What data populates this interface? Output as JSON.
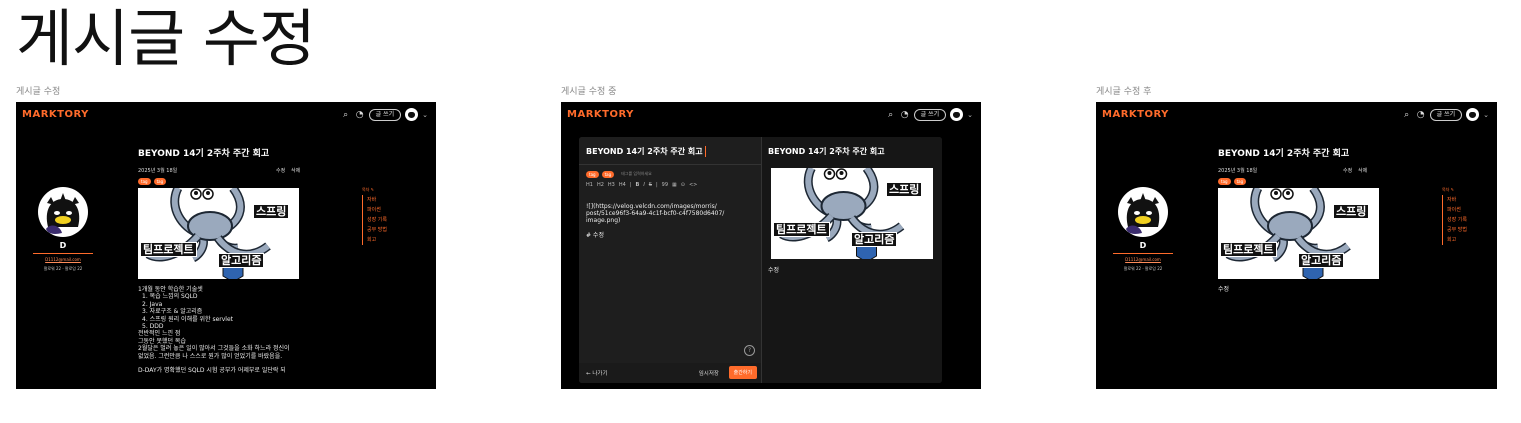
{
  "page_title": "게시글 수정",
  "captions": [
    "게시글 수정",
    "게시글 수정 중",
    "게시글 수정 후"
  ],
  "header": {
    "logo": "MARKTORY",
    "write_button": "글 쓰기",
    "icons": [
      "search-icon",
      "bell-icon",
      "avatar",
      "chevron-down-icon"
    ]
  },
  "post": {
    "title": "BEYOND 14기 2주차 주간 회고",
    "date": "2025년 3월 18일",
    "edit": "수정",
    "delete": "삭제",
    "tags": [
      "tag",
      "tag"
    ],
    "figure_labels": {
      "spring": "스프링",
      "team": "팀프로젝트",
      "algo": "알고리즘"
    },
    "body": [
      "1개월 동안 학습한 기술셋",
      "1. 복습 느낌의 SQLD",
      "2. Java",
      "3. 자료구조 & 알고리즘",
      "4. 스프링 원리 이해를 위한 servlet",
      "5. DDD",
      "전반적인 느낀 점",
      "그동안 못했던 복습",
      "2월달은 벌려 놓은 일이 많아서 그것들을 소화 하느라 정신이",
      "없었음. 그런만큼 나 스스로 뭔가 많이 얻었기를 바랐음을.",
      "",
      "D-DAY가 명확했던 SQLD 시험 공부가 어제부로 일단락 되"
    ],
    "edited_body": "수정"
  },
  "profile": {
    "name": "D",
    "email": "D1112@mail.com",
    "follow": "팔로워 22 · 팔로잉 22"
  },
  "toc": {
    "head": "목차 ✎",
    "items": [
      "자바",
      "파이썬",
      "성장 기록",
      "공부 방법",
      "회고"
    ]
  },
  "editor": {
    "title": "BEYOND 14기 2주차 주간 회고",
    "tag_placeholder": "태그를 입력하세요",
    "toolbar": [
      "H1",
      "H2",
      "H3",
      "H4",
      "|",
      "B",
      "I",
      "S",
      "|",
      "99",
      "▦",
      "⊙",
      "<>"
    ],
    "markdown": [
      "![](https://velog.velcdn.com/images/morris/",
      "post/51ce96f3-64a9-4c1f-bcf0-c4f7580d6407/",
      "image.png)",
      "",
      "# 수정"
    ],
    "exit": "← 나가기",
    "temp_save": "임시저장",
    "publish": "출간하기",
    "help": "?"
  }
}
